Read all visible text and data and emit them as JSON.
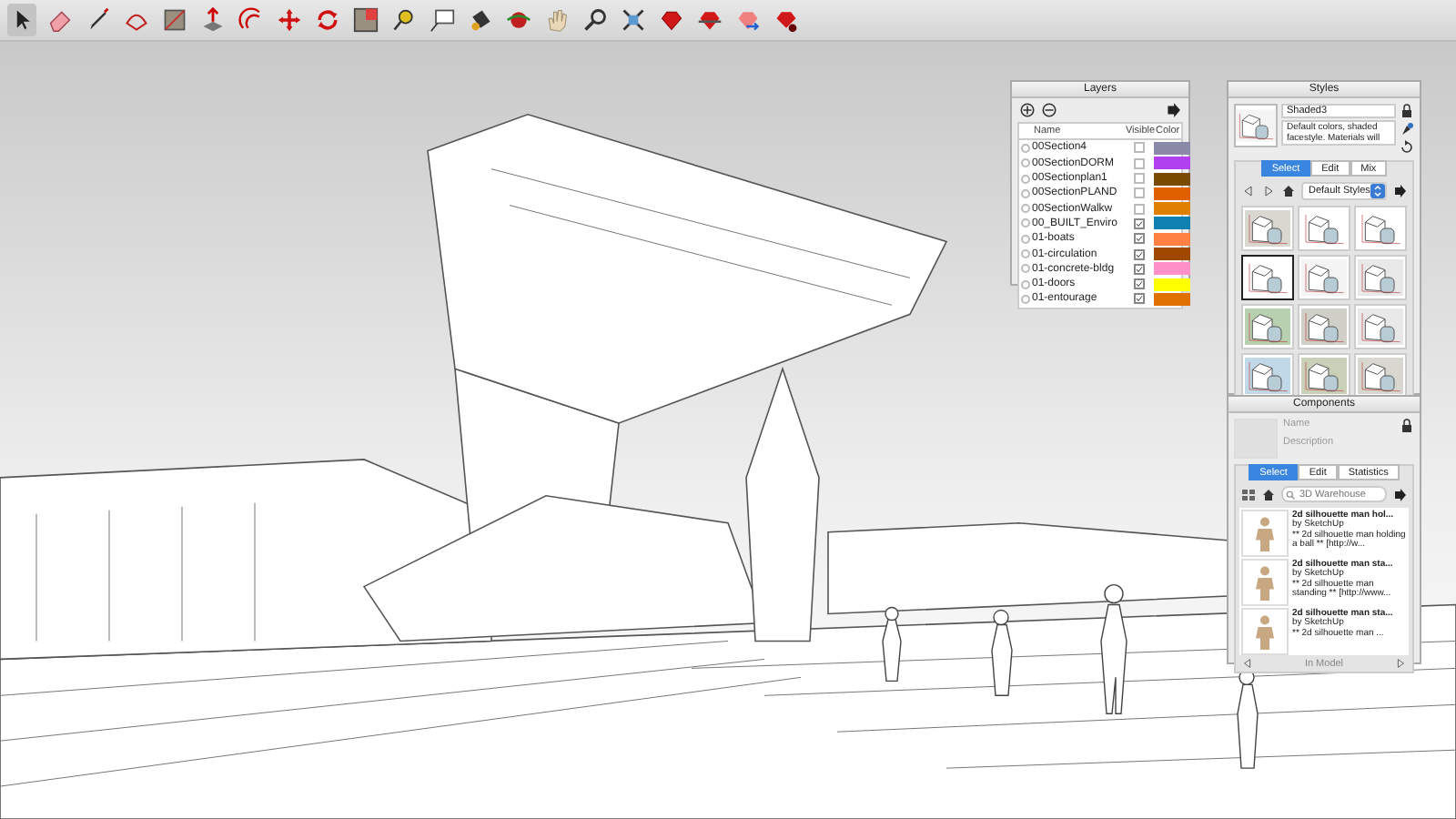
{
  "tools": [
    {
      "selected": true
    },
    {
      "selected": false
    },
    {
      "selected": false
    },
    {
      "selected": false
    },
    {
      "selected": false
    },
    {
      "selected": false
    },
    {
      "selected": false
    },
    {
      "selected": false
    },
    {
      "selected": false
    },
    {
      "selected": false
    },
    {
      "selected": false
    },
    {
      "selected": false
    },
    {
      "selected": false
    },
    {
      "selected": false
    },
    {
      "selected": false
    },
    {
      "selected": false
    },
    {
      "selected": false
    },
    {
      "selected": false
    },
    {
      "selected": false
    },
    {
      "selected": false
    },
    {
      "selected": false
    }
  ],
  "layers": {
    "title": "Layers",
    "columns": [
      "Name",
      "Visible",
      "Color"
    ],
    "rows": [
      {
        "name": "00Section4",
        "active": false,
        "visible": false,
        "color": "#8a8aa8"
      },
      {
        "name": "00SectionDORM",
        "active": false,
        "visible": false,
        "color": "#b040f0"
      },
      {
        "name": "00Sectionplan1",
        "active": false,
        "visible": false,
        "color": "#7a4a00"
      },
      {
        "name": "00SectionPLAND",
        "active": false,
        "visible": false,
        "color": "#e06000"
      },
      {
        "name": "00SectionWalkw",
        "active": false,
        "visible": false,
        "color": "#e08000"
      },
      {
        "name": "00_BUILT_Enviro",
        "active": false,
        "visible": true,
        "color": "#1080b0"
      },
      {
        "name": "01-boats",
        "active": false,
        "visible": true,
        "color": "#ff8040"
      },
      {
        "name": "01-circulation",
        "active": false,
        "visible": true,
        "color": "#a04800"
      },
      {
        "name": "01-concrete-bldg",
        "active": false,
        "visible": true,
        "color": "#ff90c8"
      },
      {
        "name": "01-doors",
        "active": false,
        "visible": true,
        "color": "#ffff00"
      },
      {
        "name": "01-entourage",
        "active": false,
        "visible": true,
        "color": "#e07000"
      }
    ]
  },
  "styles": {
    "title": "Styles",
    "style_name": "Shaded3",
    "description": "Default colors, shaded facestyle. Materials will",
    "tabs": [
      {
        "label": "Select",
        "selected": true
      },
      {
        "label": "Edit",
        "selected": false
      },
      {
        "label": "Mix",
        "selected": false
      }
    ],
    "collection": "Default Styles",
    "thumbnails": [
      {
        "selected": false
      },
      {
        "selected": false
      },
      {
        "selected": false
      },
      {
        "selected": true
      },
      {
        "selected": false
      },
      {
        "selected": false
      },
      {
        "selected": false
      },
      {
        "selected": false
      },
      {
        "selected": false
      },
      {
        "selected": false
      },
      {
        "selected": false
      },
      {
        "selected": false
      }
    ]
  },
  "components": {
    "title": "Components",
    "name_label": "Name",
    "description_label": "Description",
    "tabs": [
      {
        "label": "Select",
        "selected": true
      },
      {
        "label": "Edit",
        "selected": false
      },
      {
        "label": "Statistics",
        "selected": false
      }
    ],
    "search": {
      "placeholder": "3D Warehouse"
    },
    "items": [
      {
        "title": "2d silhouette man hol...",
        "author": "by SketchUp",
        "description": "** 2d silhouette man holding a ball ** [http://w..."
      },
      {
        "title": "2d silhouette man sta...",
        "author": "by SketchUp",
        "description": "** 2d silhouette man standing ** [http://www..."
      },
      {
        "title": "2d silhouette man sta...",
        "author": "by SketchUp",
        "description": "** 2d silhouette man ..."
      }
    ],
    "footer": "In Model"
  }
}
